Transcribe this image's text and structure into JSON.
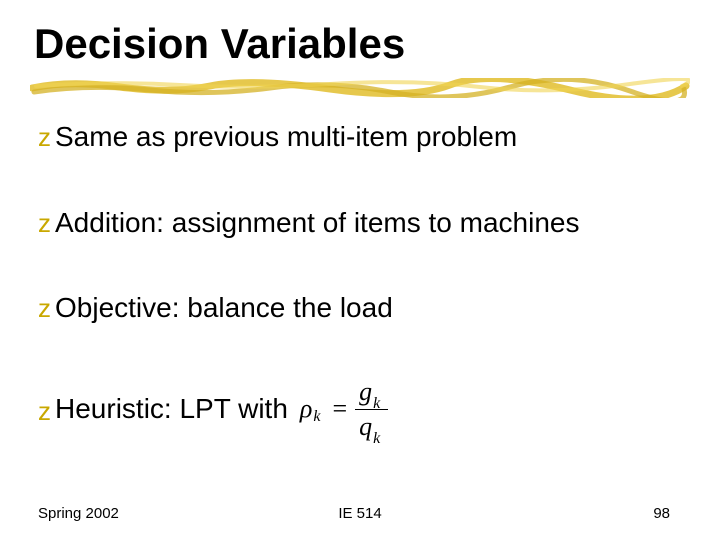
{
  "title": "Decision Variables",
  "bullets": {
    "b0": "Same as previous multi-item problem",
    "b1": "Addition: assignment of items to machines",
    "b2": "Objective: balance the load",
    "b3": "Heuristic: LPT with"
  },
  "formula": {
    "lhs_sym": "ρ",
    "lhs_sub": "k",
    "eq": "=",
    "num_sym": "g",
    "num_sub": "k",
    "den_sym": "q",
    "den_sub": "k"
  },
  "footer": {
    "left": "Spring 2002",
    "center": "IE 514",
    "right": "98"
  },
  "bullet_glyph": "z"
}
